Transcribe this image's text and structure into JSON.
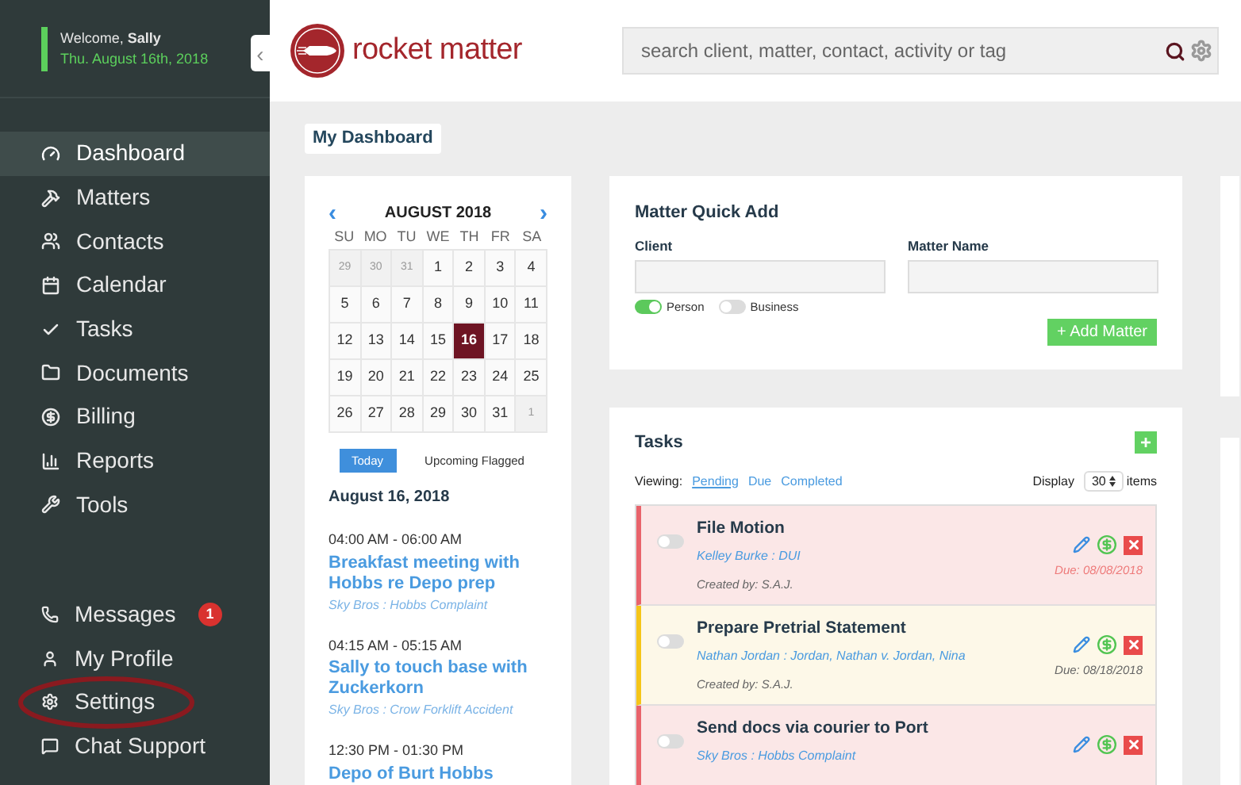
{
  "sidebar": {
    "welcome": "Welcome, **Sally**",
    "date": "Thu. August 16th, 2018",
    "collapse": "‹",
    "items": [
      {
        "label": "Dashboard",
        "selected": true
      },
      {
        "label": "Matters",
        "selected": false
      },
      {
        "label": "Contacts",
        "selected": false
      },
      {
        "label": "Calendar",
        "selected": false
      },
      {
        "label": "Tasks",
        "selected": false
      },
      {
        "label": "Documents",
        "selected": false
      },
      {
        "label": "Billing",
        "selected": false
      },
      {
        "label": "Reports",
        "selected": false
      },
      {
        "label": "Tools",
        "selected": false
      }
    ],
    "bottom_items": [
      {
        "label": "Messages",
        "badge": "1",
        "highlighted": false
      },
      {
        "label": "My Profile",
        "highlighted": false
      },
      {
        "label": "Settings",
        "highlighted": true
      },
      {
        "label": "Chat Support",
        "highlighted": false
      }
    ]
  },
  "header": {
    "logo": "rocket matter",
    "search": {
      "placeholder": "search client, matter, contact, activity or tag"
    }
  },
  "page_title": "My Dashboard",
  "calendar": {
    "month": "AUGUST 2018",
    "prev": "‹",
    "next": "›",
    "weekdays": [
      "SU",
      "MO",
      "TU",
      "WE",
      "TH",
      "FR",
      "SA"
    ],
    "weeks": [
      [
        {
          "day": "29",
          "muted": true,
          "selected": false
        },
        {
          "day": "30",
          "muted": true,
          "selected": false
        },
        {
          "day": "31",
          "muted": true,
          "selected": false
        },
        {
          "day": "1",
          "muted": false,
          "selected": false
        },
        {
          "day": "2",
          "muted": false,
          "selected": false
        },
        {
          "day": "3",
          "muted": false,
          "selected": false
        },
        {
          "day": "4",
          "muted": false,
          "selected": false
        }
      ],
      [
        {
          "day": "5",
          "muted": false,
          "selected": false
        },
        {
          "day": "6",
          "muted": false,
          "selected": false
        },
        {
          "day": "7",
          "muted": false,
          "selected": false
        },
        {
          "day": "8",
          "muted": false,
          "selected": false
        },
        {
          "day": "9",
          "muted": false,
          "selected": false
        },
        {
          "day": "10",
          "muted": false,
          "selected": false
        },
        {
          "day": "11",
          "muted": false,
          "selected": false
        }
      ],
      [
        {
          "day": "12",
          "muted": false,
          "selected": false
        },
        {
          "day": "13",
          "muted": false,
          "selected": false
        },
        {
          "day": "14",
          "muted": false,
          "selected": false
        },
        {
          "day": "15",
          "muted": false,
          "selected": false
        },
        {
          "day": "16",
          "muted": false,
          "selected": true
        },
        {
          "day": "17",
          "muted": false,
          "selected": false
        },
        {
          "day": "18",
          "muted": false,
          "selected": false
        }
      ],
      [
        {
          "day": "19",
          "muted": false,
          "selected": false
        },
        {
          "day": "20",
          "muted": false,
          "selected": false
        },
        {
          "day": "21",
          "muted": false,
          "selected": false
        },
        {
          "day": "22",
          "muted": false,
          "selected": false
        },
        {
          "day": "23",
          "muted": false,
          "selected": false
        },
        {
          "day": "24",
          "muted": false,
          "selected": false
        },
        {
          "day": "25",
          "muted": false,
          "selected": false
        }
      ],
      [
        {
          "day": "26",
          "muted": false,
          "selected": false
        },
        {
          "day": "27",
          "muted": false,
          "selected": false
        },
        {
          "day": "28",
          "muted": false,
          "selected": false
        },
        {
          "day": "29",
          "muted": false,
          "selected": false
        },
        {
          "day": "30",
          "muted": false,
          "selected": false
        },
        {
          "day": "31",
          "muted": false,
          "selected": false
        },
        {
          "day": "1",
          "muted": true,
          "selected": false
        }
      ]
    ],
    "views": [
      {
        "label": "Today",
        "selected": true
      },
      {
        "label": "Upcoming Flagged",
        "selected": false
      }
    ],
    "agenda_date": "August 16, 2018",
    "events": [
      {
        "time": "04:00 AM - 06:00 AM",
        "title": "Breakfast meeting with Hobbs re Depo prep",
        "matter": "Sky Bros : Hobbs Complaint"
      },
      {
        "time": "04:15 AM - 05:15 AM",
        "title": "Sally to touch base with Zuckerkorn",
        "matter": "Sky Bros : Crow Forklift Accident"
      },
      {
        "time": "12:30 PM - 01:30 PM",
        "title": "Depo of Burt Hobbs"
      }
    ]
  },
  "quick_add": {
    "title": "Matter Quick Add",
    "client_label": "Client",
    "matter_label": "Matter Name",
    "types": [
      {
        "label": "Person",
        "on": true
      },
      {
        "label": "Business",
        "on": false
      }
    ],
    "button": "+ Add Matter"
  },
  "tasks": {
    "title": "Tasks",
    "add": "+",
    "viewing_label": "Viewing:",
    "filters": [
      {
        "label": "Pending",
        "selected": true
      },
      {
        "label": "Due",
        "selected": false
      },
      {
        "label": "Completed",
        "selected": false
      }
    ],
    "display_label": "Display",
    "display_value": "30",
    "items_label": "items",
    "items": [
      {
        "title": "File Motion",
        "matter": "Kelley Burke : DUI",
        "created": "Created by: S.A.J.",
        "due": "Due: 08/08/2018",
        "overdue": true,
        "done": false,
        "color": "#e8636b"
      },
      {
        "title": "Prepare Pretrial Statement",
        "matter": "Nathan Jordan : Jordan, Nathan v. Jordan, Nina",
        "created": "Created by: S.A.J.",
        "due": "Due: 08/18/2018",
        "overdue": false,
        "done": false,
        "color": "#f5c518"
      },
      {
        "title": "Send docs via courier to Port",
        "matter": "Sky Bros : Hobbs Complaint",
        "overdue": true,
        "done": false,
        "color": "#e8636b"
      }
    ]
  }
}
